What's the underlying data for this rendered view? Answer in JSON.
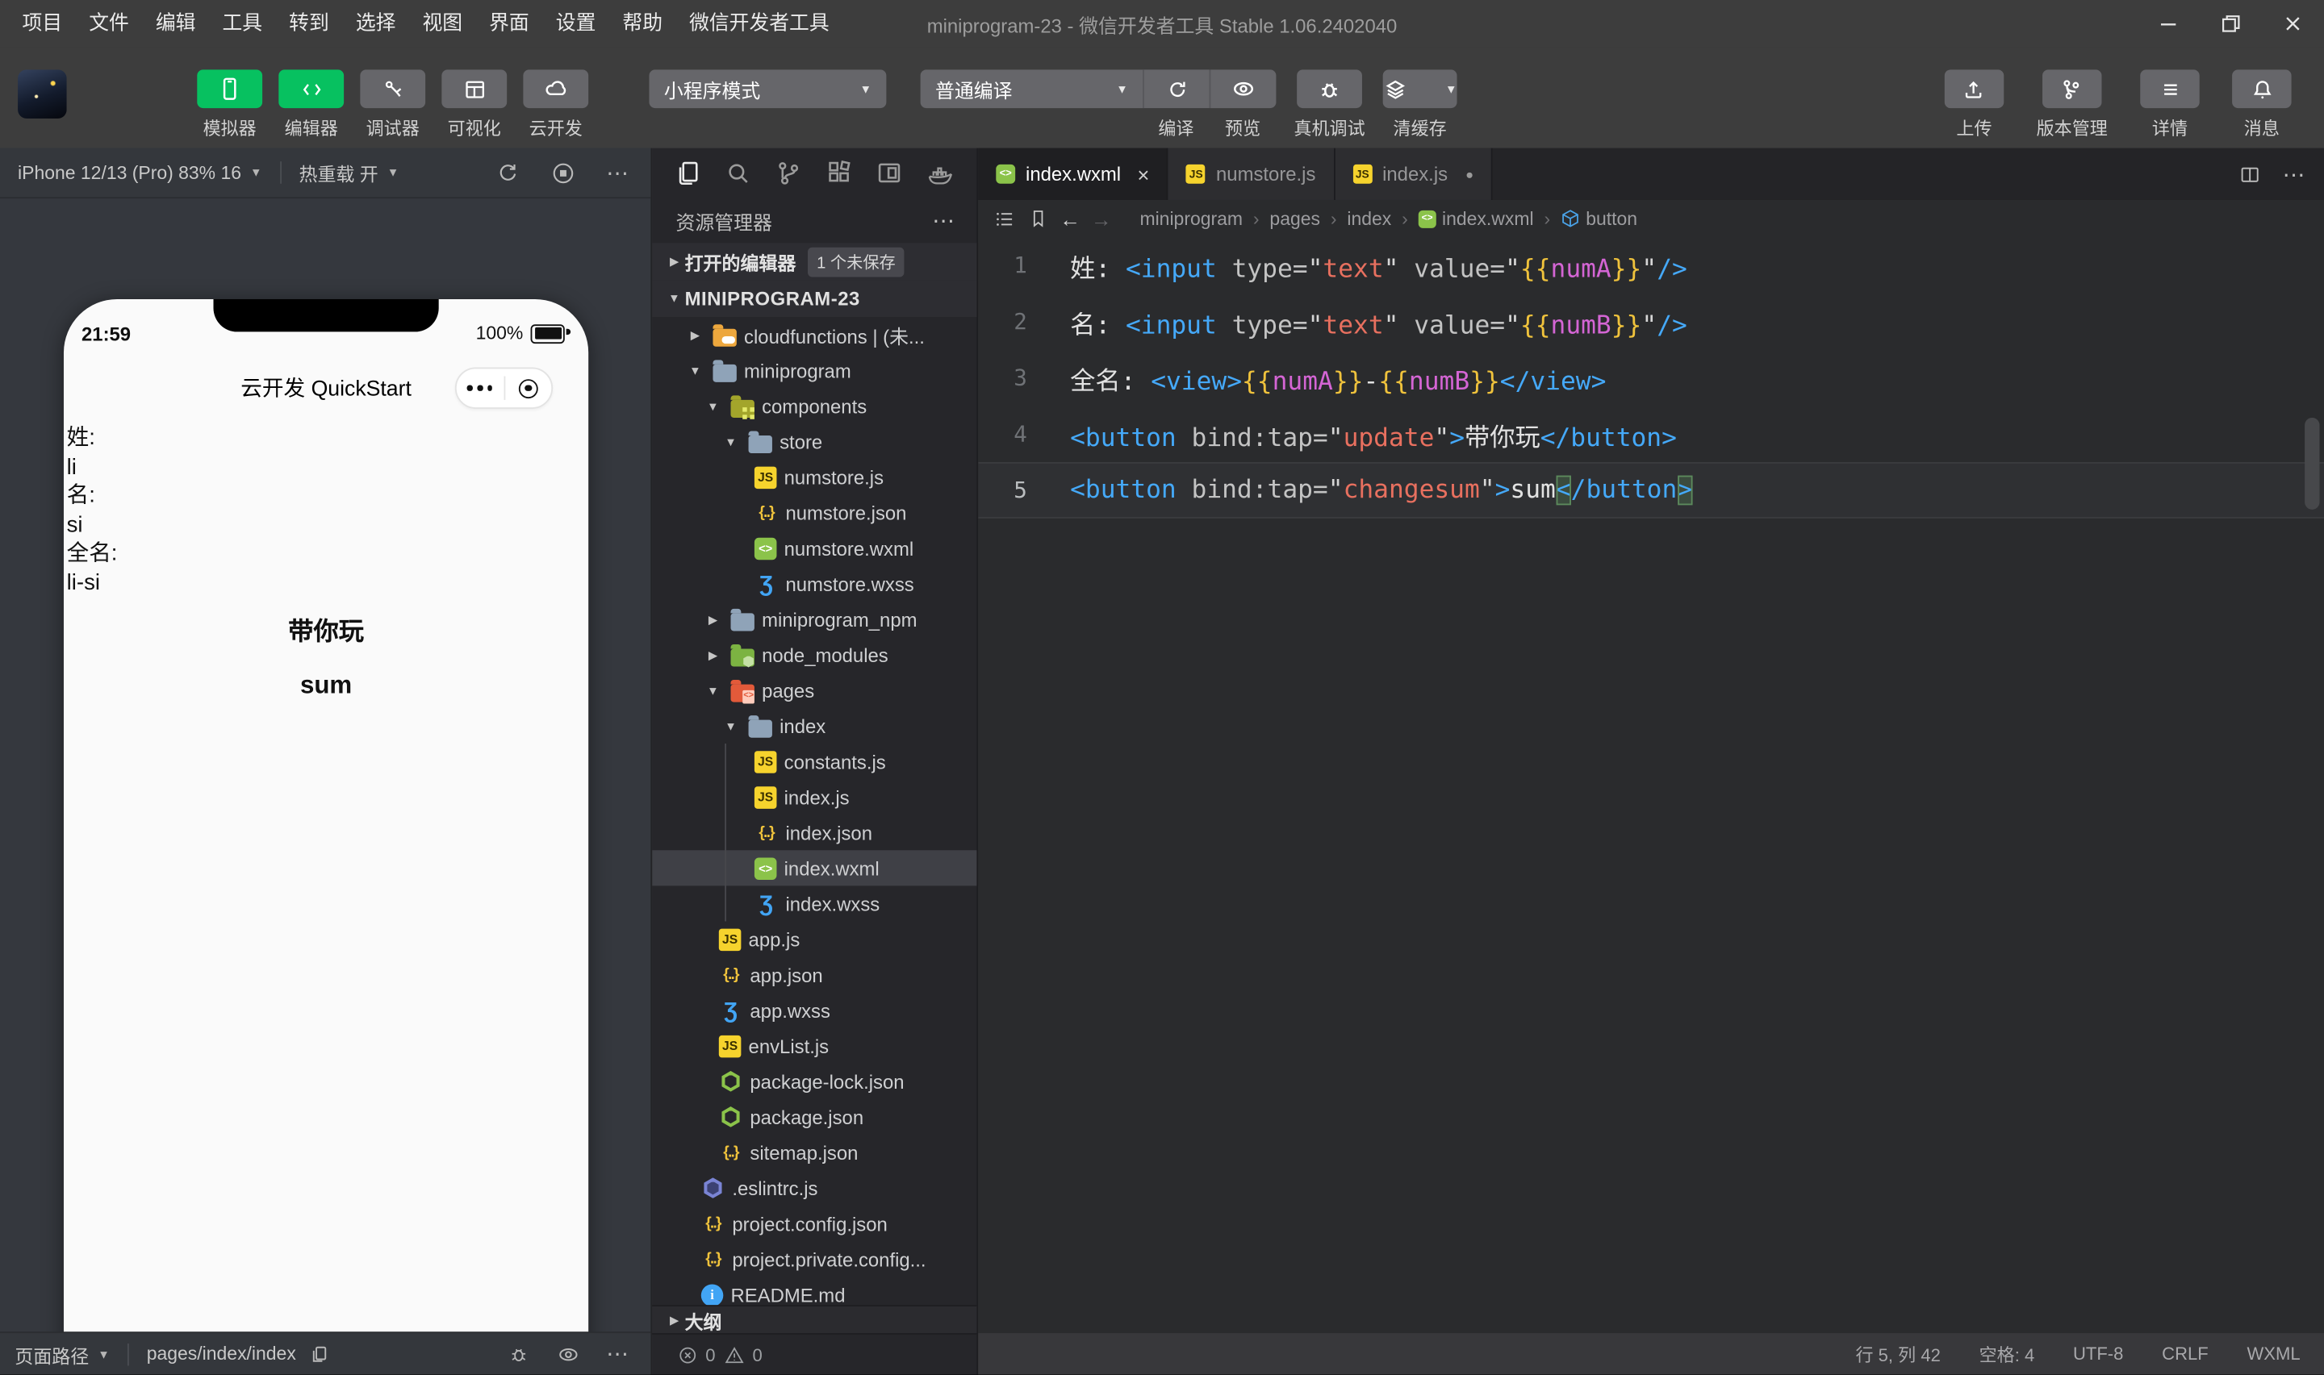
{
  "colors": {
    "brand_green": "#07C160",
    "tag_blue": "#45A9F9",
    "string_red": "#E8705F",
    "brace_yellow": "#EFC23C",
    "var_magenta": "#D465D4"
  },
  "window": {
    "menu": [
      "项目",
      "文件",
      "编辑",
      "工具",
      "转到",
      "选择",
      "视图",
      "界面",
      "设置",
      "帮助",
      "微信开发者工具"
    ],
    "title": "miniprogram-23 - 微信开发者工具 Stable 1.06.2402040"
  },
  "toolbar": {
    "left_buttons": [
      {
        "label": "模拟器",
        "icon": "phone",
        "active": true
      },
      {
        "label": "编辑器",
        "icon": "code",
        "active": true
      },
      {
        "label": "调试器",
        "icon": "debug",
        "active": false
      },
      {
        "label": "可视化",
        "icon": "layout",
        "active": false
      },
      {
        "label": "云开发",
        "icon": "cloud",
        "active": false
      }
    ],
    "mode_dropdown": "小程序模式",
    "compile_dropdown": "普通编译",
    "compile_buttons": [
      {
        "label": "编译",
        "icon": "refresh",
        "joined": true
      },
      {
        "label": "预览",
        "icon": "eye",
        "joined": true
      },
      {
        "label": "真机调试",
        "icon": "bug"
      },
      {
        "label": "清缓存",
        "icon": "layers",
        "caret": true
      }
    ],
    "right_buttons": [
      {
        "label": "上传",
        "icon": "upload"
      },
      {
        "label": "版本管理",
        "icon": "branch"
      },
      {
        "label": "详情",
        "icon": "list"
      },
      {
        "label": "消息",
        "icon": "bell"
      }
    ]
  },
  "simulator": {
    "device_label": "iPhone 12/13 (Pro) 83% 16",
    "hot_reload_label": "热重载 开",
    "phone": {
      "time": "21:59",
      "battery_pct": "100%",
      "nav_title": "云开发 QuickStart",
      "content_lines": [
        "姓:",
        "li",
        "名:",
        "si",
        "全名:",
        "li-si"
      ],
      "buttons": [
        "带你玩",
        "sum"
      ]
    },
    "bottom": {
      "path_label": "页面路径",
      "path_value": "pages/index/index"
    }
  },
  "explorer": {
    "panel_title": "资源管理器",
    "open_editors_label": "打开的编辑器",
    "unsaved_badge": "1 个未保存",
    "project_name": "MINIPROGRAM-23",
    "outline_label": "大纲",
    "problems": {
      "errors": "0",
      "warnings": "0"
    },
    "tree": [
      {
        "label": "cloudfunctions | (未...",
        "icon": "folder-cloud",
        "lvl": 1,
        "arrow": "r"
      },
      {
        "label": "miniprogram",
        "icon": "folder",
        "lvl": 1,
        "arrow": "d"
      },
      {
        "label": "components",
        "icon": "folder-comp",
        "lvl": 2,
        "arrow": "d"
      },
      {
        "label": "store",
        "icon": "folder",
        "lvl": 3,
        "arrow": "d"
      },
      {
        "label": "numstore.js",
        "icon": "js",
        "lvl": 4
      },
      {
        "label": "numstore.json",
        "icon": "json",
        "lvl": 4
      },
      {
        "label": "numstore.wxml",
        "icon": "wxml",
        "lvl": 4
      },
      {
        "label": "numstore.wxss",
        "icon": "wxss",
        "lvl": 4
      },
      {
        "label": "miniprogram_npm",
        "icon": "folder",
        "lvl": 2,
        "arrow": "r"
      },
      {
        "label": "node_modules",
        "icon": "folder-node",
        "lvl": 2,
        "arrow": "r"
      },
      {
        "label": "pages",
        "icon": "folder-pages",
        "lvl": 2,
        "arrow": "d"
      },
      {
        "label": "index",
        "icon": "folder",
        "lvl": 3,
        "arrow": "d"
      },
      {
        "label": "constants.js",
        "icon": "js",
        "lvl": 4,
        "guide": true
      },
      {
        "label": "index.js",
        "icon": "js",
        "lvl": 4,
        "guide": true
      },
      {
        "label": "index.json",
        "icon": "json",
        "lvl": 4,
        "guide": true
      },
      {
        "label": "index.wxml",
        "icon": "wxml",
        "lvl": 4,
        "selected": true,
        "guide": true
      },
      {
        "label": "index.wxss",
        "icon": "wxss",
        "lvl": 4,
        "guide": true
      },
      {
        "label": "app.js",
        "icon": "js",
        "lvl": 2
      },
      {
        "label": "app.json",
        "icon": "json",
        "lvl": 2
      },
      {
        "label": "app.wxss",
        "icon": "wxss",
        "lvl": 2
      },
      {
        "label": "envList.js",
        "icon": "js",
        "lvl": 2
      },
      {
        "label": "package-lock.json",
        "icon": "node",
        "lvl": 2
      },
      {
        "label": "package.json",
        "icon": "node",
        "lvl": 2
      },
      {
        "label": "sitemap.json",
        "icon": "json",
        "lvl": 2
      },
      {
        "label": ".eslintrc.js",
        "icon": "eslint",
        "lvl": 1
      },
      {
        "label": "project.config.json",
        "icon": "json",
        "lvl": 1
      },
      {
        "label": "project.private.config...",
        "icon": "json",
        "lvl": 1
      },
      {
        "label": "README.md",
        "icon": "readme",
        "lvl": 1
      }
    ]
  },
  "editor": {
    "tabs": [
      {
        "label": "index.wxml",
        "icon": "wxml",
        "active": true,
        "close": true
      },
      {
        "label": "numstore.js",
        "icon": "js"
      },
      {
        "label": "index.js",
        "icon": "js",
        "dirty": true
      }
    ],
    "breadcrumb": [
      {
        "label": "miniprogram"
      },
      {
        "label": "pages"
      },
      {
        "label": "index"
      },
      {
        "label": "index.wxml",
        "icon": "wxml"
      },
      {
        "label": "button",
        "icon": "cube"
      }
    ],
    "code_lines": [
      {
        "tokens": [
          [
            "p",
            "姓: "
          ],
          [
            "t",
            "<input"
          ],
          [
            "a",
            " type="
          ],
          [
            "q",
            "\""
          ],
          [
            "s",
            "text"
          ],
          [
            "q",
            "\""
          ],
          [
            "a",
            " value="
          ],
          [
            "q",
            "\""
          ],
          [
            "b",
            "{{"
          ],
          [
            "v",
            "numA"
          ],
          [
            "b",
            "}}"
          ],
          [
            "q",
            "\""
          ],
          [
            "t",
            "/>"
          ]
        ]
      },
      {
        "tokens": [
          [
            "p",
            "名: "
          ],
          [
            "t",
            "<input"
          ],
          [
            "a",
            " type="
          ],
          [
            "q",
            "\""
          ],
          [
            "s",
            "text"
          ],
          [
            "q",
            "\""
          ],
          [
            "a",
            " value="
          ],
          [
            "q",
            "\""
          ],
          [
            "b",
            "{{"
          ],
          [
            "v",
            "numB"
          ],
          [
            "b",
            "}}"
          ],
          [
            "q",
            "\""
          ],
          [
            "t",
            "/>"
          ]
        ]
      },
      {
        "tokens": [
          [
            "p",
            "全名: "
          ],
          [
            "t",
            "<view>"
          ],
          [
            "b",
            "{{"
          ],
          [
            "v",
            "numA"
          ],
          [
            "b",
            "}}"
          ],
          [
            "p",
            "-"
          ],
          [
            "b",
            "{{"
          ],
          [
            "v",
            "numB"
          ],
          [
            "b",
            "}}"
          ],
          [
            "t",
            "</view>"
          ]
        ]
      },
      {
        "tokens": [
          [
            "t",
            "<button"
          ],
          [
            "a",
            " bind:tap="
          ],
          [
            "q",
            "\""
          ],
          [
            "s",
            "update"
          ],
          [
            "q",
            "\""
          ],
          [
            "t",
            ">"
          ],
          [
            "p",
            "带你玩"
          ],
          [
            "t",
            "</button>"
          ]
        ]
      },
      {
        "current": true,
        "tokens": [
          [
            "t",
            "<button"
          ],
          [
            "a",
            " bind:tap="
          ],
          [
            "q",
            "\""
          ],
          [
            "s",
            "changesum"
          ],
          [
            "q",
            "\""
          ],
          [
            "t",
            ">"
          ],
          [
            "p",
            "sum"
          ],
          [
            "m",
            "<"
          ],
          [
            "t",
            "/button"
          ],
          [
            "m",
            ">"
          ]
        ]
      }
    ],
    "status_items": [
      "行 5, 列 42",
      "空格: 4",
      "UTF-8",
      "CRLF",
      "WXML"
    ]
  }
}
